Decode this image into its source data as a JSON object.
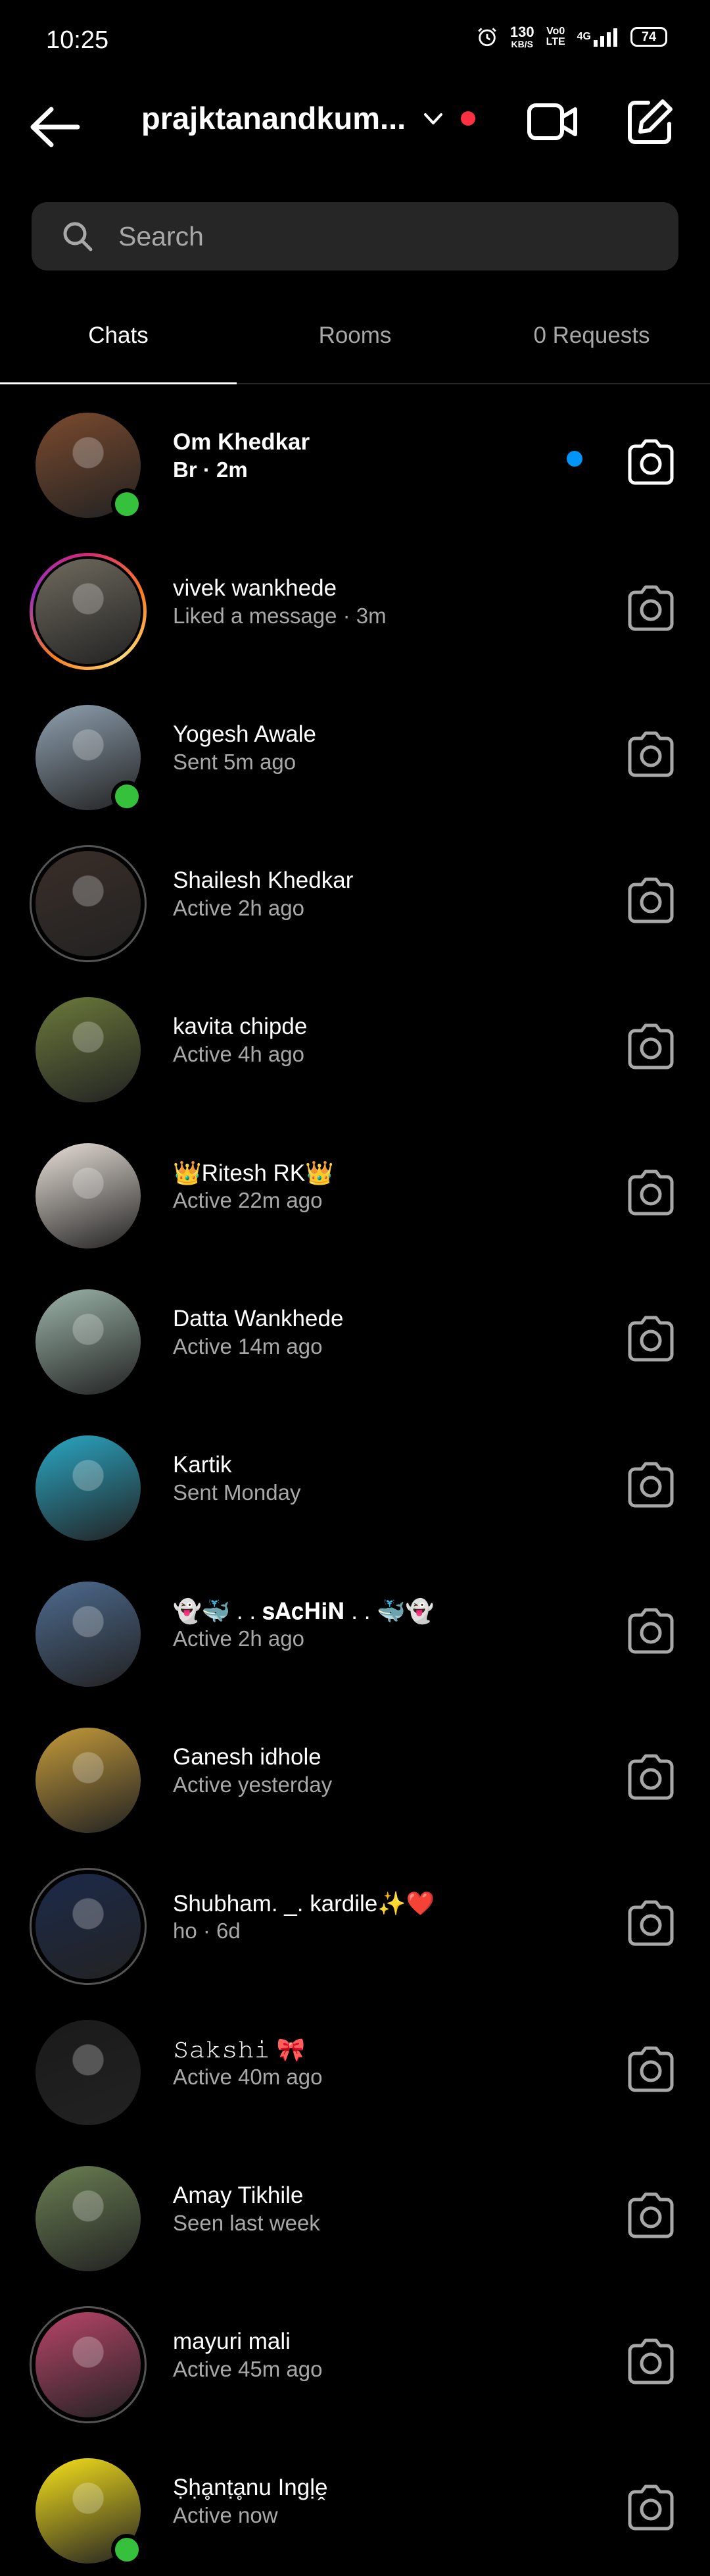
{
  "status_bar": {
    "time": "10:25",
    "net_speed_value": "130",
    "net_speed_unit": "KB/S",
    "volte_top": "Vo0",
    "volte_bottom": "LTE",
    "network": "4G",
    "battery": "74"
  },
  "header": {
    "username": "prajktanandkum...",
    "back_icon": "arrow-left-icon",
    "video_icon": "video-camera-icon",
    "compose_icon": "compose-icon"
  },
  "search": {
    "placeholder": "Search",
    "value": ""
  },
  "tabs": [
    {
      "label": "Chats",
      "active": true
    },
    {
      "label": "Rooms",
      "active": false
    },
    {
      "label": "0 Requests",
      "active": false
    }
  ],
  "chats": [
    {
      "name": "Om Khedkar",
      "status": "Br · 2m",
      "unread": true,
      "online": true,
      "ring": "none",
      "avatar_color": "#7b4a2e"
    },
    {
      "name": "vivek wankhede",
      "status": "Liked a message · 3m",
      "unread": false,
      "online": false,
      "ring": "story",
      "avatar_color": "#6f6a5e"
    },
    {
      "name": "Yogesh Awale",
      "status": "Sent 5m ago",
      "unread": false,
      "online": true,
      "ring": "none",
      "avatar_color": "#8fa1b0"
    },
    {
      "name": "Shailesh Khedkar",
      "status": "Active 2h ago",
      "unread": false,
      "online": false,
      "ring": "grey",
      "avatar_color": "#3a2e28"
    },
    {
      "name": "kavita chipde",
      "status": "Active 4h ago",
      "unread": false,
      "online": false,
      "ring": "none",
      "avatar_color": "#6b7a3a"
    },
    {
      "name": "👑Ritesh RK👑",
      "status": "Active 22m ago",
      "unread": false,
      "online": false,
      "ring": "none",
      "avatar_color": "#e8e0d8"
    },
    {
      "name": "Datta Wankhede",
      "status": "Active 14m ago",
      "unread": false,
      "online": false,
      "ring": "none",
      "avatar_color": "#9bb4a8"
    },
    {
      "name": "Kartik",
      "status": "Sent Monday",
      "unread": false,
      "online": false,
      "ring": "none",
      "avatar_color": "#2aa7c4"
    },
    {
      "name": "👻🐳 . . 𝐬𝐀𝐜𝐇𝐢𝐍 . . 🐳👻",
      "status": "Active 2h ago",
      "unread": false,
      "online": false,
      "ring": "none",
      "avatar_color": "#4d6b8f"
    },
    {
      "name": "Ganesh idhole",
      "status": "Active yesterday",
      "unread": false,
      "online": false,
      "ring": "none",
      "avatar_color": "#c49b3a"
    },
    {
      "name": "Shubham. _. kardile✨❤️",
      "status": "ho · 6d",
      "unread": false,
      "online": false,
      "ring": "grey",
      "avatar_color": "#1c2a4a"
    },
    {
      "name": "𝚂𝚊𝚔𝚜𝚑𝚒 🎀",
      "status": "Active 40m ago",
      "unread": false,
      "online": false,
      "ring": "none",
      "avatar_color": "#1a1a1a"
    },
    {
      "name": "Amay Tikhile",
      "status": "Seen last week",
      "unread": false,
      "online": false,
      "ring": "none",
      "avatar_color": "#6a7f52"
    },
    {
      "name": "mayuri mali",
      "status": "Active 45m ago",
      "unread": false,
      "online": false,
      "ring": "grey",
      "avatar_color": "#b8456a"
    },
    {
      "name": "Ṣḥḁnṭḁnu Ingḷḙ",
      "status": "Active now",
      "unread": false,
      "online": true,
      "ring": "none",
      "avatar_color": "#f7e21b"
    }
  ]
}
